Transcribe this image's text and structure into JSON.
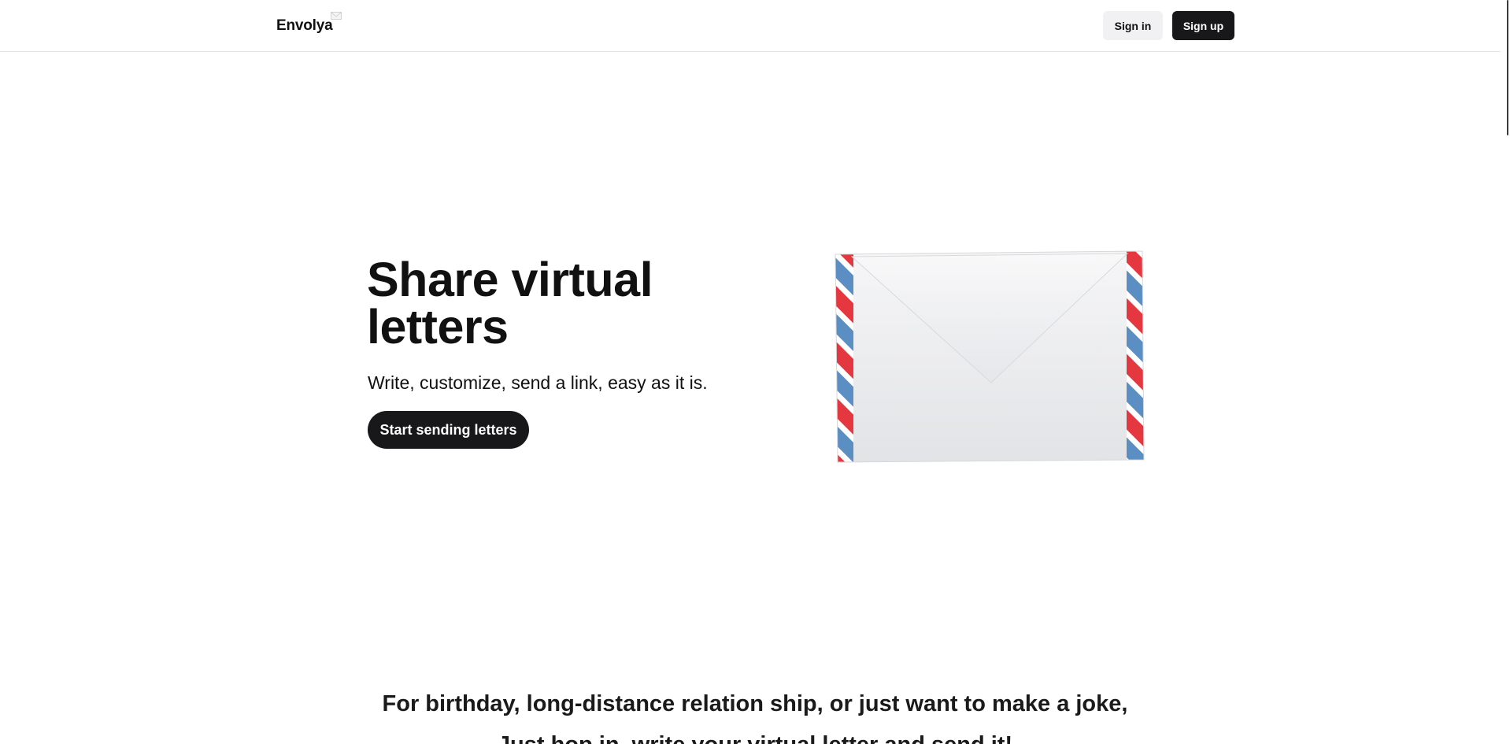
{
  "header": {
    "brand": "Envolya",
    "brand_icon": "envelope-icon",
    "signin_label": "Sign in",
    "signup_label": "Sign up"
  },
  "hero": {
    "title": "Share virtual letters",
    "subtitle": "Write, customize, send a link, easy as it is.",
    "cta_label": "Start sending letters",
    "illustration": "airmail-envelope-image"
  },
  "tagline": {
    "line1": "For birthday, long-distance relation ship, or just want to make a joke,",
    "line2": "Just hop in, write your virtual letter and send it!"
  },
  "colors": {
    "primary": "#18181b",
    "secondary_bg": "#f1f1f3",
    "airmail_red": "#e5373f",
    "airmail_blue": "#5b8fc4"
  }
}
